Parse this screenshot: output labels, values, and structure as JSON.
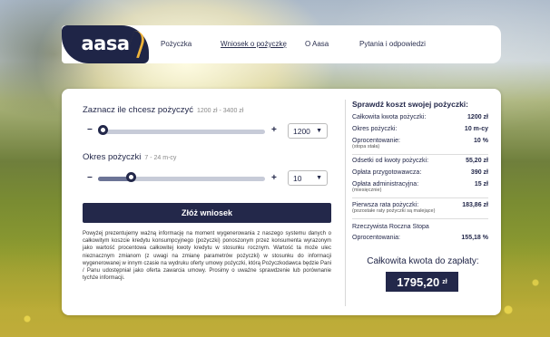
{
  "brand": {
    "logo": "aasa"
  },
  "nav": {
    "items": [
      {
        "label": "Pożyczka"
      },
      {
        "label": "Wniosek o pożyczkę"
      },
      {
        "label": "O Aasa"
      },
      {
        "label": "Pytania i odpowiedzi"
      }
    ]
  },
  "calculator": {
    "amount": {
      "label": "Zaznacz ile chcesz pożyczyć",
      "range": "1200 zł - 3400 zł",
      "selected": "1200",
      "slider_fraction": 0.0
    },
    "period": {
      "label": "Okres pożyczki",
      "range": "7 - 24 m-cy",
      "selected": "10",
      "slider_fraction": 0.18
    },
    "minus": "−",
    "plus": "+",
    "submit_label": "Złóż wniosek",
    "disclaimer": "Powyżej prezentujemy ważną informację na moment wygenerowania z naszego systemu danych o całkowitym koszcie kredytu konsumpcyjnego (pożyczki) ponoszonym przez konsumenta wyrazonym jako wartość procentowa całkowitej kwoty kredytu w stosunku rocznym. Wartość ta może ulec nieznacznym zmianom (z uwagi na zmianę parametrów pożyczki) w stosunku do informacji wygenerowanej w innym czasie na wydruku oferty umowy pożyczki, którą Pożyczkodawca będzie Pani / Panu udostępniał jako oferta zawarcia umowy. Prosimy o uważne sprawdzenie lub porównanie tychże informacji."
  },
  "summary": {
    "title": "Sprawdź koszt swojej pożyczki:",
    "rows": [
      {
        "label": "Całkowita kwota pożyczki:",
        "value": "1200 zł"
      },
      {
        "label": "Okres pożyczki:",
        "value": "10 m-cy"
      },
      {
        "label": "Oprocentowanie:",
        "value": "10 %",
        "note": "(stopa stała)"
      },
      {
        "label": "Odsetki od kwoty pożyczki:",
        "value": "55,20 zł"
      },
      {
        "label": "Opłata przygotowawcza:",
        "value": "390 zł"
      },
      {
        "label": "Opłata administracyjna:",
        "value": "15 zł",
        "note": "(miesięcznie)"
      },
      {
        "label": "Pierwsza rata pożyczki:",
        "value": "183,86 zł",
        "note": "(pozostałe raty pożyczki są malejące)"
      },
      {
        "label": "Rzeczywista Roczna Stopa",
        "value": ""
      },
      {
        "label": "Oprocentowania:",
        "value": "155,18 %"
      }
    ],
    "total_label": "Całkowita kwota do zapłaty:",
    "total_value": "1795,20",
    "total_unit": "zł"
  }
}
